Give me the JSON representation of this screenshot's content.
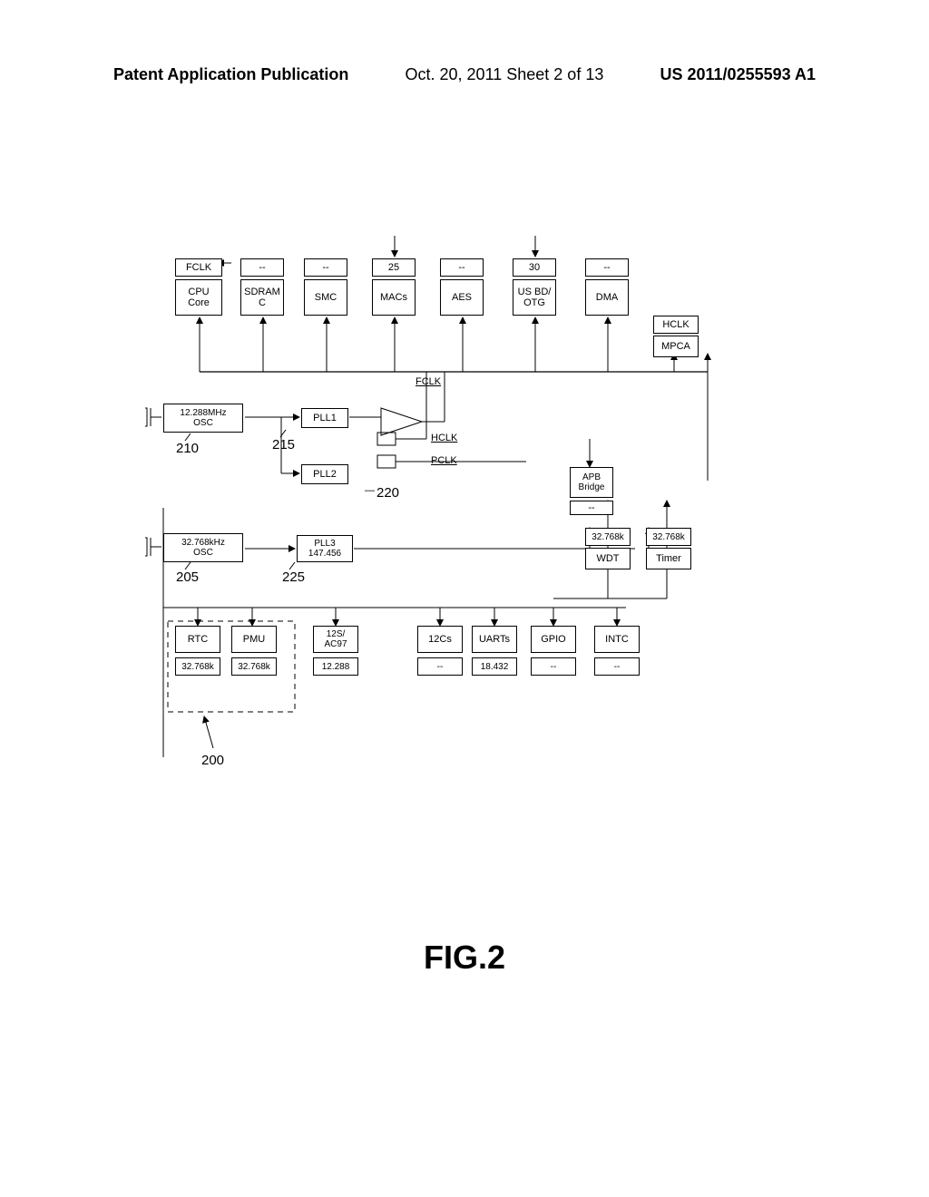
{
  "header": {
    "left": "Patent Application Publication",
    "middle": "Oct. 20, 2011   Sheet 2 of 13",
    "right": "US 2011/0255593 A1"
  },
  "figure_label": "FIG.2",
  "refs": {
    "r210": "210",
    "r205": "205",
    "r215": "215",
    "r220": "220",
    "r225": "225",
    "r200": "200"
  },
  "top": {
    "fclk": "FCLK",
    "cpu": "CPU\nCore",
    "sdram": "SDRAM\nC",
    "smc": "SMC",
    "macs25": "25",
    "macs": "MACs",
    "aes": "AES",
    "usbd30": "30",
    "usbd": "US BD/\nOTG",
    "dma": "DMA",
    "hclk": "HCLK",
    "mpca": "MPCA"
  },
  "mid": {
    "fclk_bus": "FCLK",
    "hclk_bus": "HCLK",
    "pclk_bus": "PCLK",
    "osc12": "12.288MHz\nOSC",
    "osc32": "32.768kHz\nOSC",
    "pll1": "PLL1",
    "pll2": "PLL2",
    "pll3": "PLL3\n147.456",
    "apb": "APB\nBridge",
    "wdt_top": "32.768k",
    "timer_top": "32.768k",
    "wdt": "WDT",
    "timer": "Timer"
  },
  "bot": {
    "rtc": "RTC",
    "rtc2": "32.768k",
    "pmu": "PMU",
    "pmu2": "32.768k",
    "i2s": "12S/\nAC97",
    "i2s2": "12.288",
    "i2c": "12Cs",
    "i2c2": "--",
    "uart": "UARTs",
    "uart2": "18.432",
    "gpio": "GPIO",
    "gpio2": "--",
    "intc": "INTC",
    "intc2": "--",
    "smallbox_top1": "--",
    "smallbox_top2": "--",
    "smallbox_top3": "--",
    "smallbox_top4": "--",
    "smallbox_top5": "--",
    "smallbox_right": "--"
  }
}
